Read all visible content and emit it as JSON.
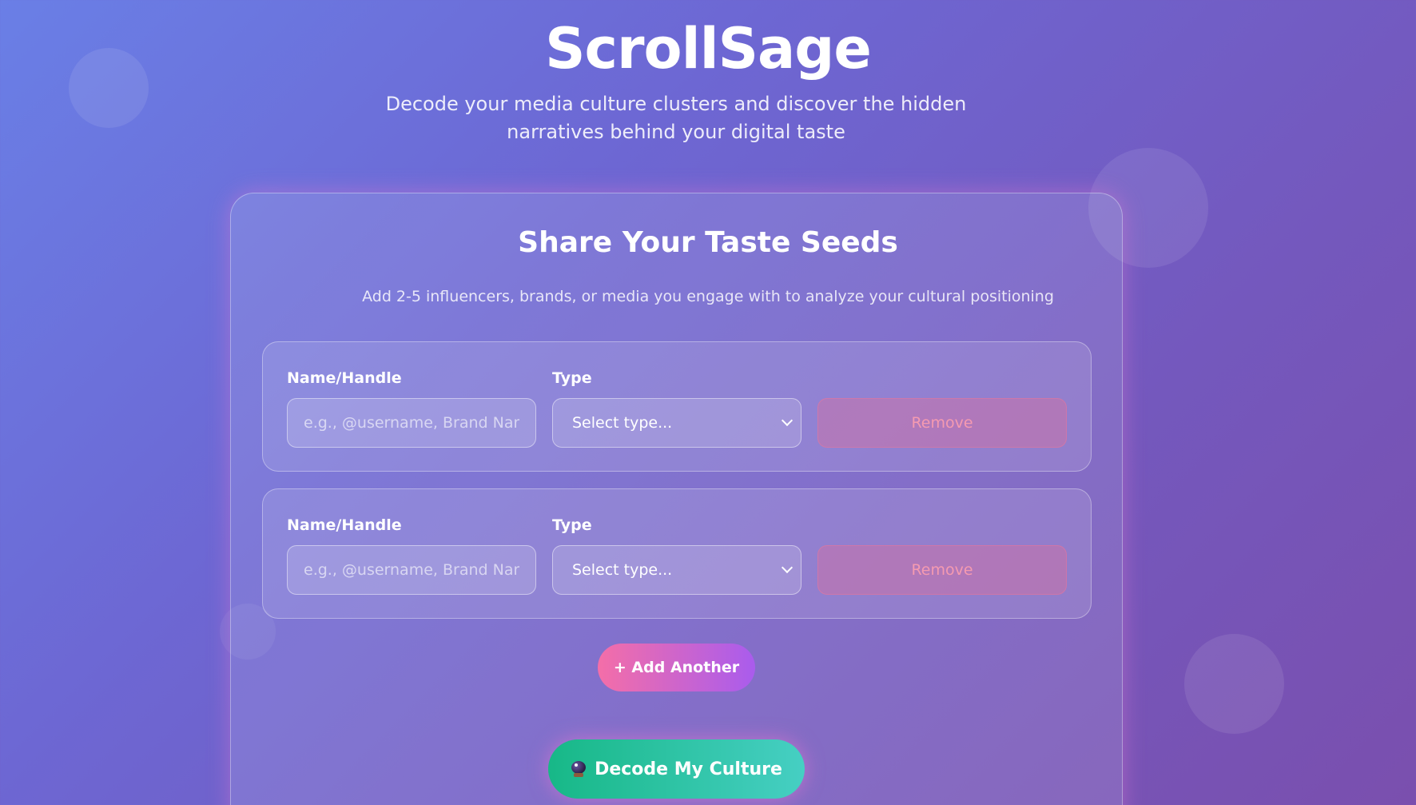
{
  "header": {
    "title": "ScrollSage",
    "subtitle": "Decode your media culture clusters and discover the hidden narratives behind your digital taste"
  },
  "card": {
    "title": "Share Your Taste Seeds",
    "description": "Add 2-5 influencers, brands, or media you engage with to analyze your cultural positioning"
  },
  "seeds": [
    {
      "name_label": "Name/Handle",
      "name_value": "",
      "name_placeholder": "e.g., @username, Brand Name, Show Title",
      "type_label": "Type",
      "type_selected": "Select type...",
      "remove_label": "Remove"
    },
    {
      "name_label": "Name/Handle",
      "name_value": "",
      "name_placeholder": "e.g., @username, Brand Name, Show Title",
      "type_label": "Type",
      "type_selected": "Select type...",
      "remove_label": "Remove"
    }
  ],
  "actions": {
    "add_another_label": "+ Add Another",
    "decode_label": "Decode My Culture",
    "decode_icon": "crystal-ball-icon"
  },
  "colors": {
    "background_start": "#6a7fe6",
    "background_end": "#7a4fae",
    "add_button_start": "#f46ea8",
    "add_button_end": "#a95ced",
    "decode_button_start": "#17b887",
    "decode_button_end": "#46cfc3",
    "remove_text": "#f59ab0"
  }
}
